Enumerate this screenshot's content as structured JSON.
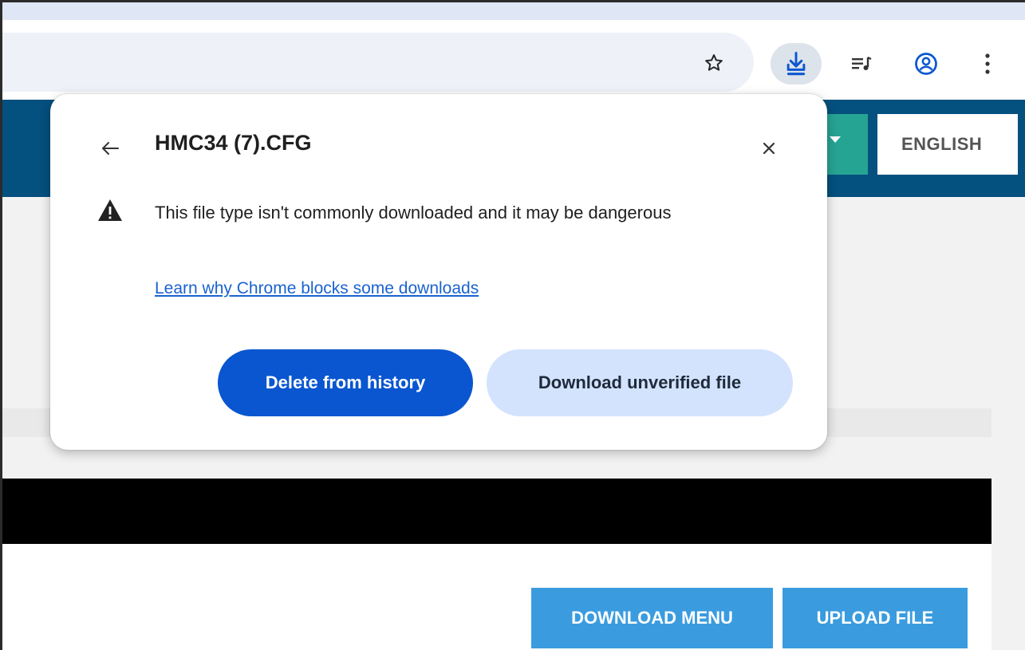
{
  "browser": {
    "toolbar_icons": [
      "star-icon",
      "download-icon",
      "tab-search-icon",
      "profile-icon",
      "menu-icon"
    ]
  },
  "site": {
    "language_label": "ENGLISH",
    "buttons": {
      "download_menu": "DOWNLOAD MENU",
      "upload_file": "UPLOAD FILE"
    },
    "colors": {
      "header": "#04507e",
      "green_button": "#26a493",
      "action_button": "#3a9cdf"
    }
  },
  "download_popup": {
    "filename": "HMC34 (7).CFG",
    "warning": "This file type isn't commonly downloaded and it may be dangerous",
    "learn_link": "Learn why Chrome blocks some downloads",
    "delete_label": "Delete from history",
    "download_label": "Download unverified file",
    "colors": {
      "primary_button": "#0a56d0",
      "secondary_button": "#d3e3fd",
      "link": "#1a63d0"
    }
  }
}
